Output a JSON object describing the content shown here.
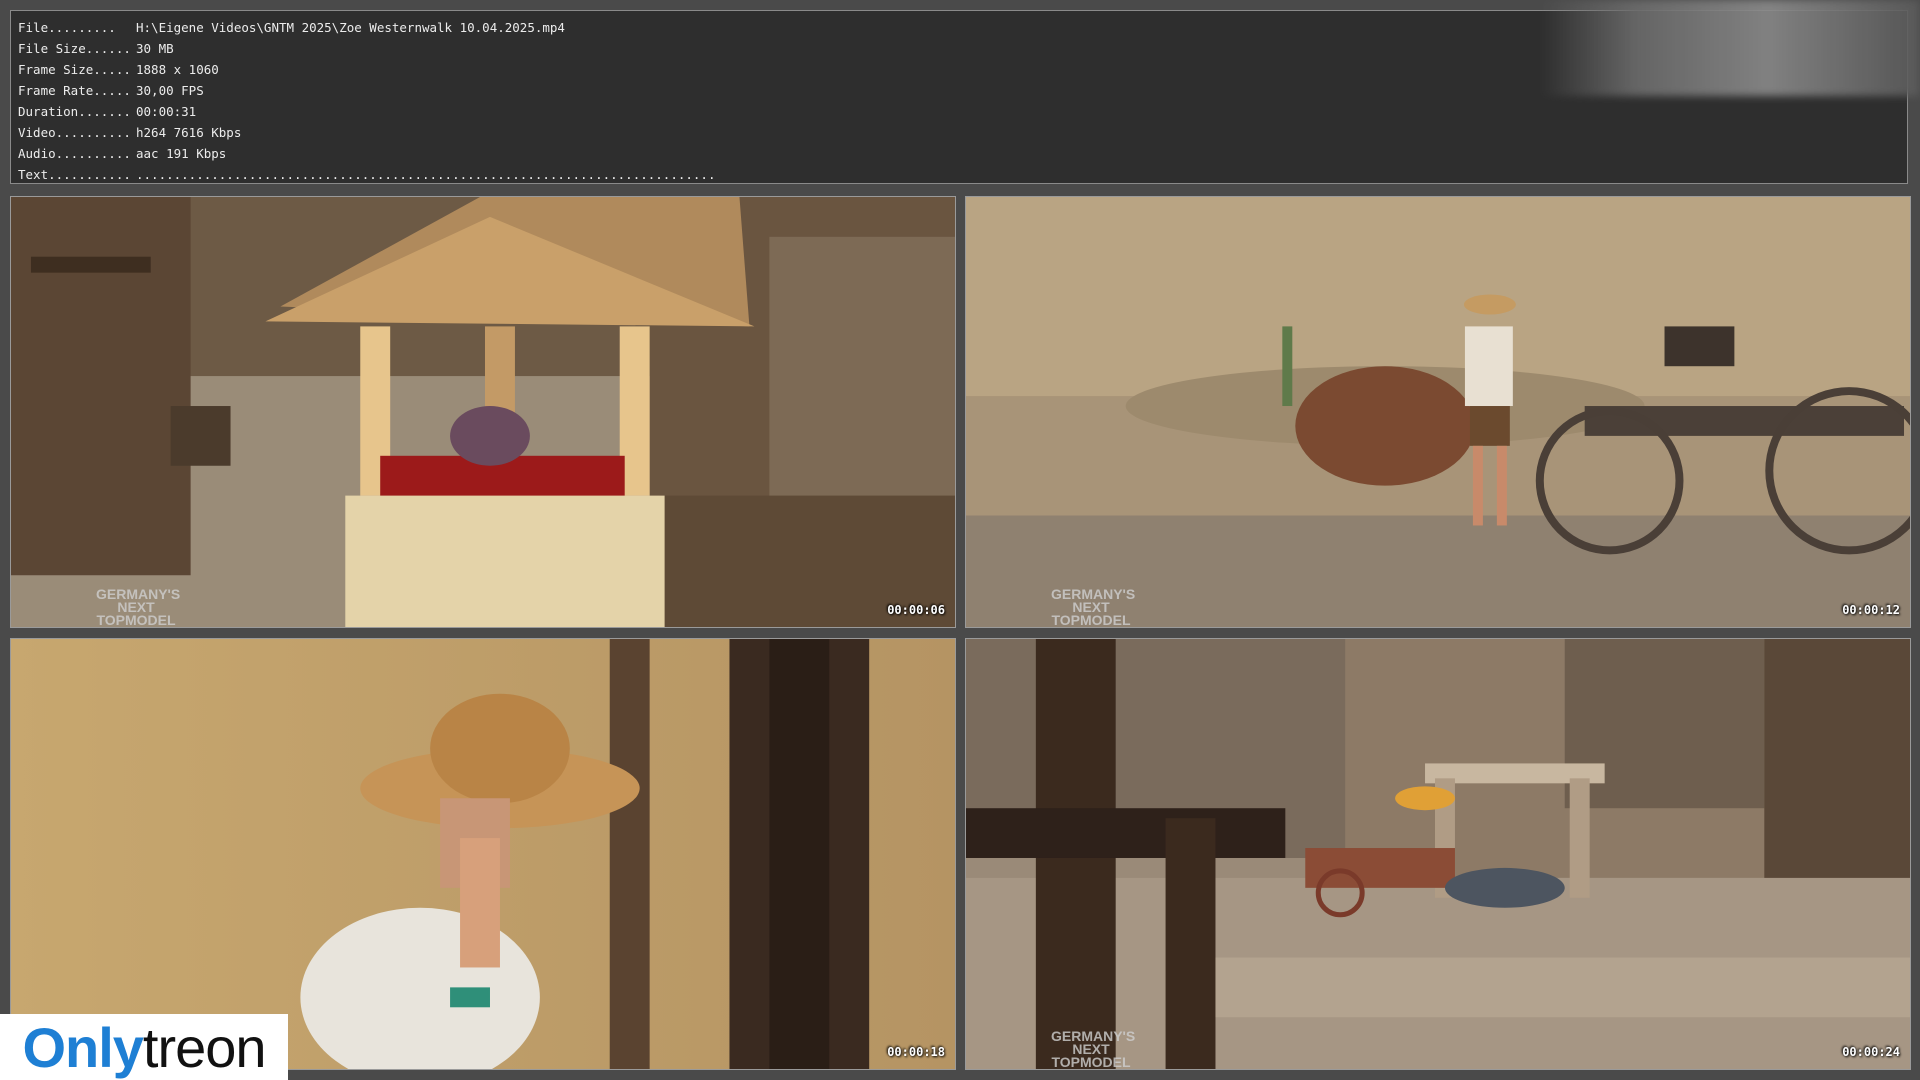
{
  "info": {
    "rows": [
      {
        "key": "File.........",
        "value": "H:\\Eigene Videos\\GNTM 2025\\Zoe Westernwalk 10.04.2025.mp4"
      },
      {
        "key": "File Size......",
        "value": "30 MB"
      },
      {
        "key": "Frame Size.....",
        "value": "1888 x 1060"
      },
      {
        "key": "Frame Rate.....",
        "value": "30,00 FPS"
      },
      {
        "key": "Duration.......",
        "value": "00:00:31"
      },
      {
        "key": "Video..........",
        "value": "h264 7616 Kbps"
      },
      {
        "key": "Audio..........",
        "value": "aac 191 Kbps"
      },
      {
        "key": "Text...........",
        "value": "............................................................................."
      }
    ]
  },
  "frames": [
    {
      "timestamp": "00:00:06",
      "watermark": [
        "GERMANY'S",
        "NEXT",
        "TOPMODEL"
      ]
    },
    {
      "timestamp": "00:00:12",
      "watermark": [
        "GERMANY'S",
        "NEXT",
        "TOPMODEL"
      ]
    },
    {
      "timestamp": "00:00:18"
    },
    {
      "timestamp": "00:00:24",
      "watermark": [
        "GERMANY'S",
        "NEXT",
        "TOPMODEL"
      ]
    }
  ],
  "brand": {
    "part1": "Only",
    "part2": "treon",
    "color1": "#1e7fd4",
    "color2": "#111111"
  }
}
